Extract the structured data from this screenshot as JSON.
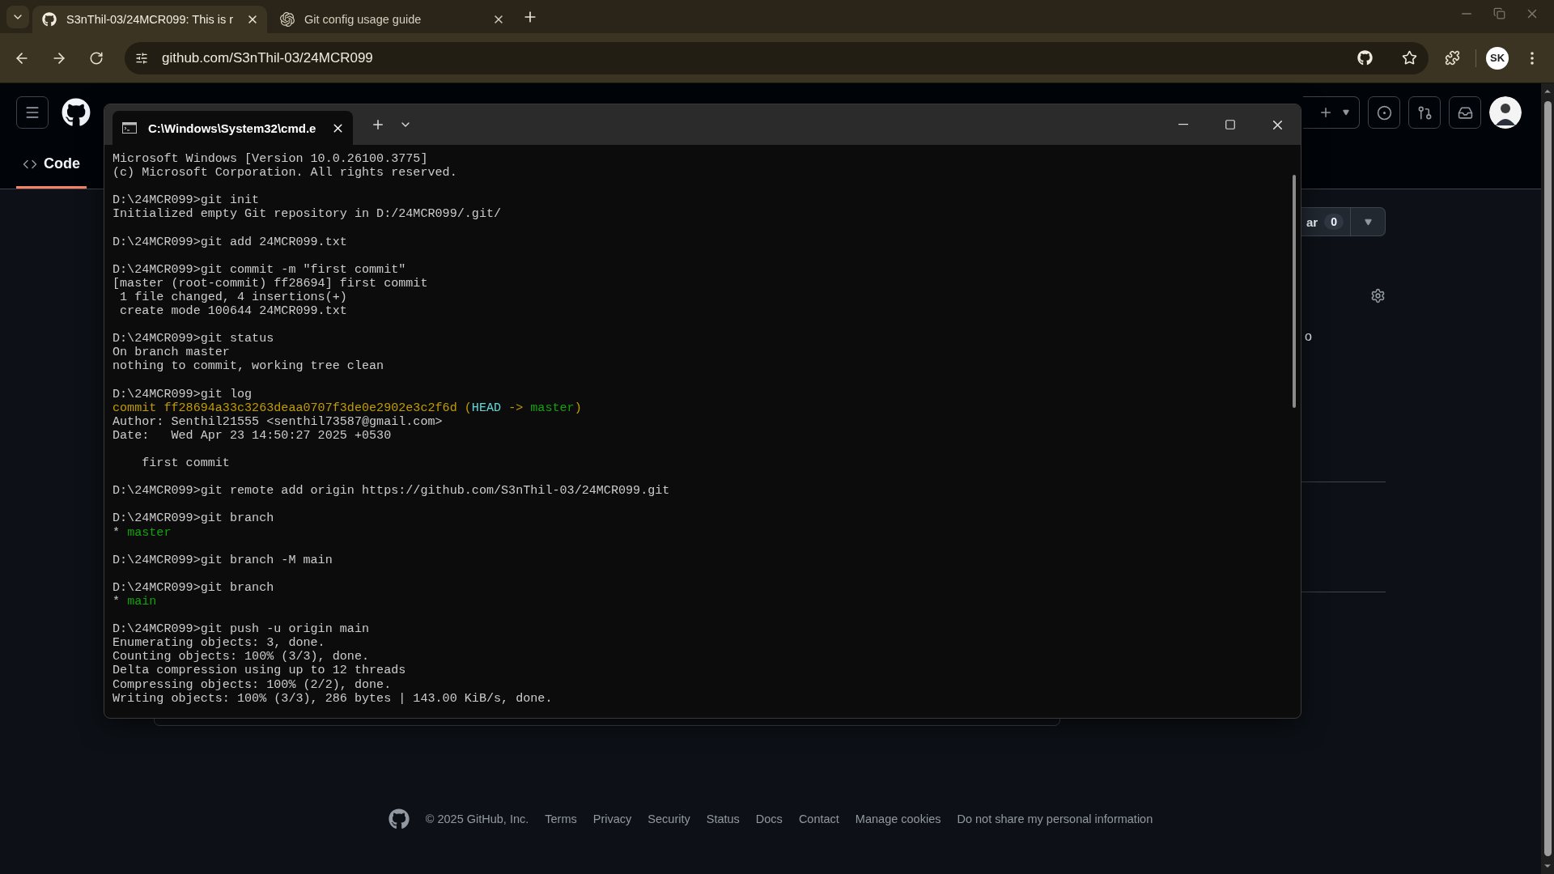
{
  "browser": {
    "tabs": [
      {
        "title": "S3nThil-03/24MCR099: This is r",
        "selected": true
      },
      {
        "title": "Git config usage guide",
        "selected": false
      }
    ],
    "url": "github.com/S3nThil-03/24MCR099",
    "profile": "SK"
  },
  "github": {
    "tabs": [
      {
        "label": "Code",
        "selected": true
      }
    ],
    "star": {
      "label": "ar",
      "count": "0"
    },
    "sidebar_fragment": "o",
    "footer": {
      "copyright": "© 2025 GitHub, Inc.",
      "links": [
        "Terms",
        "Privacy",
        "Security",
        "Status",
        "Docs",
        "Contact",
        "Manage cookies",
        "Do not share my personal information"
      ]
    }
  },
  "terminal": {
    "tab_title": "C:\\Windows\\System32\\cmd.e",
    "blocks": [
      [
        "Microsoft Windows [Version 10.0.26100.3775]",
        "(c) Microsoft Corporation. All rights reserved."
      ],
      [
        "D:\\24MCR099>git init",
        "Initialized empty Git repository in D:/24MCR099/.git/"
      ],
      [
        "D:\\24MCR099>git add 24MCR099.txt"
      ],
      [
        "D:\\24MCR099>git commit -m \"first commit\"",
        "[master (root-commit) ff28694] first commit",
        " 1 file changed, 4 insertions(+)",
        " create mode 100644 24MCR099.txt"
      ],
      [
        "D:\\24MCR099>git status",
        "On branch master",
        "nothing to commit, working tree clean"
      ],
      [
        "D:\\24MCR099>git log",
        [
          {
            "text": "commit ff28694a33c3263deaa0707f3de0e2902e3c2f6d (",
            "kind": "commit"
          },
          {
            "text": "HEAD",
            "kind": "head"
          },
          {
            "text": " -> ",
            "kind": "commit"
          },
          {
            "text": "master",
            "kind": "branch"
          },
          {
            "text": ")",
            "kind": "commit"
          }
        ],
        "Author: Senthil21555 <senthil73587@gmail.com>",
        "Date:   Wed Apr 23 14:50:27 2025 +0530"
      ],
      [
        "    first commit"
      ],
      [
        "D:\\24MCR099>git remote add origin https://github.com/S3nThil-03/24MCR099.git"
      ],
      [
        "D:\\24MCR099>git branch",
        [
          {
            "text": "* ",
            "kind": "plain"
          },
          {
            "text": "master",
            "kind": "branch"
          }
        ]
      ],
      [
        "D:\\24MCR099>git branch -M main"
      ],
      [
        "D:\\24MCR099>git branch",
        [
          {
            "text": "* ",
            "kind": "plain"
          },
          {
            "text": "main",
            "kind": "branch"
          }
        ]
      ],
      [
        "D:\\24MCR099>git push -u origin main",
        "Enumerating objects: 3, done.",
        "Counting objects: 100% (3/3), done.",
        "Delta compression using up to 12 threads",
        "Compressing objects: 100% (2/2), done.",
        "Writing objects: 100% (3/3), 286 bytes | 143.00 KiB/s, done."
      ]
    ]
  }
}
